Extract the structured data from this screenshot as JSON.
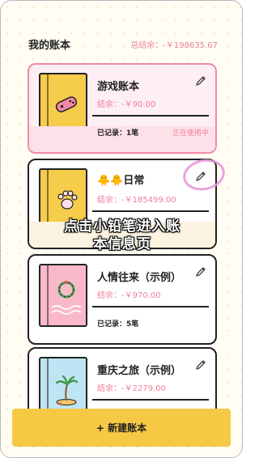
{
  "header": {
    "title": "我的账本",
    "total_label": "总结余：-￥198635.67"
  },
  "books": [
    {
      "name": "游戏账本",
      "balance": "结余：-￥90.00",
      "recorded": "已记录：1笔",
      "status": "正在使用中",
      "cover_icon": "game-controller-icon",
      "cover_color": "#f6cc4b",
      "active": true
    },
    {
      "name": "🐥🐥日常",
      "balance": "结余：-￥185499.00",
      "recorded": "",
      "status": "",
      "cover_icon": "paw-icon",
      "cover_color": "#f6cc4b",
      "active": false
    },
    {
      "name": "人情往来（示例）",
      "balance": "结余：-￥970.00",
      "recorded": "已记录：5笔",
      "status": "",
      "cover_icon": "wreath-icon",
      "cover_color": "#f9b9c9",
      "active": false
    },
    {
      "name": "重庆之旅（示例）",
      "balance": "结余：-￥2279.00",
      "recorded": "",
      "status": "",
      "cover_icon": "palm-tree-icon",
      "cover_color": "#bfe4f4",
      "active": false
    }
  ],
  "overlay": {
    "line1": "点击小铅笔进入账",
    "line2": "本信息页"
  },
  "new_book_button": "+ 新建账本",
  "colors": {
    "accent_pink": "#ef7f99",
    "accent_yellow": "#f6c944",
    "highlight_ring": "#e794d8"
  }
}
